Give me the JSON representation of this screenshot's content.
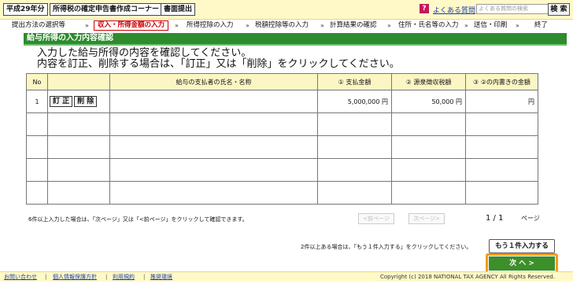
{
  "topbar": {
    "era_label": "平成29年分",
    "corner_label": "所得税の確定申告書作成コーナー",
    "print_label": "書面提出",
    "help_icon": "?",
    "faq_link": "よくある質問",
    "faq_placeholder": "よくある質問の検索",
    "search_label": "検 索"
  },
  "steps": [
    "提出方法の選択等",
    "収入・所得金額の入力",
    "所得控除の入力",
    "税額控除等の入力",
    "計算結果の確認",
    "住所・氏名等の入力",
    "送信・印刷",
    "終了"
  ],
  "section_title": "給与所得の入力内容確認",
  "instructions": [
    "入力した給与所得の内容を確認してください。",
    "内容を訂正、削除する場合は、「訂正」又は「削除」をクリックしてください。"
  ],
  "table": {
    "headers": [
      "No",
      "",
      "給与の支払者の氏名・名称",
      "① 支払金額",
      "② 源泉徴収税額",
      "③ ②の内書きの金額"
    ],
    "rows": [
      {
        "no": "1",
        "edit": "訂 正",
        "delete": "削 除",
        "payer": "",
        "paid": "5,000,000 円",
        "withheld": "50,000 円",
        "inner": "円"
      }
    ]
  },
  "paging": {
    "note": "6件以上入力した場合は、「次ページ」又は「<前ページ」をクリックして確認できます。",
    "prev_label": "<前ページ",
    "next_label": "次ページ>",
    "indicator": "1 / 1",
    "unit": "ページ"
  },
  "more": {
    "note": "2件以上ある場合は、「もう１件入力する」をクリックしてください。",
    "button": "もう１件入力する"
  },
  "next_button": "次 へ >",
  "footer": {
    "links": [
      "お問い合わせ",
      "個人情報保護方針",
      "利用規約",
      "推奨環境"
    ],
    "copyright": "Copyright (c) 2018 NATIONAL TAX AGENCY All Rights Reserved."
  },
  "colors": {
    "accent_green": "#2e8b2e",
    "highlight_orange": "#f39a1c",
    "header_yellow": "#fff9c8",
    "current_step_red": "#cc0000"
  }
}
